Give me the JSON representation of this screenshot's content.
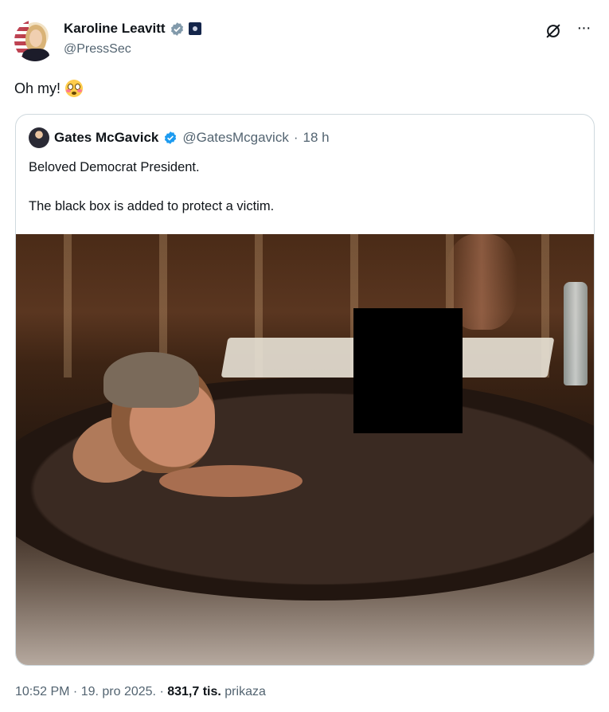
{
  "author": {
    "display_name": "Karoline Leavitt",
    "handle": "@PressSec"
  },
  "tweet": {
    "text": "Oh my!",
    "emoji_icon": "flushed-face-emoji"
  },
  "quoted": {
    "display_name": "Gates McGavick",
    "handle": "@GatesMcgavick",
    "separator": "·",
    "time": "18 h",
    "line1": "Beloved Democrat President.",
    "line2": "The black box is added to protect a victim."
  },
  "meta": {
    "timestamp": "10:52 PM · 19. pro 2025. · ",
    "views_count": "831,7 tis.",
    "views_label": "prikaza"
  },
  "icons": {
    "verified": "verified-badge-icon",
    "government": "government-affiliation-icon",
    "grok": "grok-icon",
    "more": "more-options-icon"
  },
  "colors": {
    "verified_blue": "#1d9bf0",
    "secondary_text": "#536471",
    "border": "#cfd9de"
  }
}
